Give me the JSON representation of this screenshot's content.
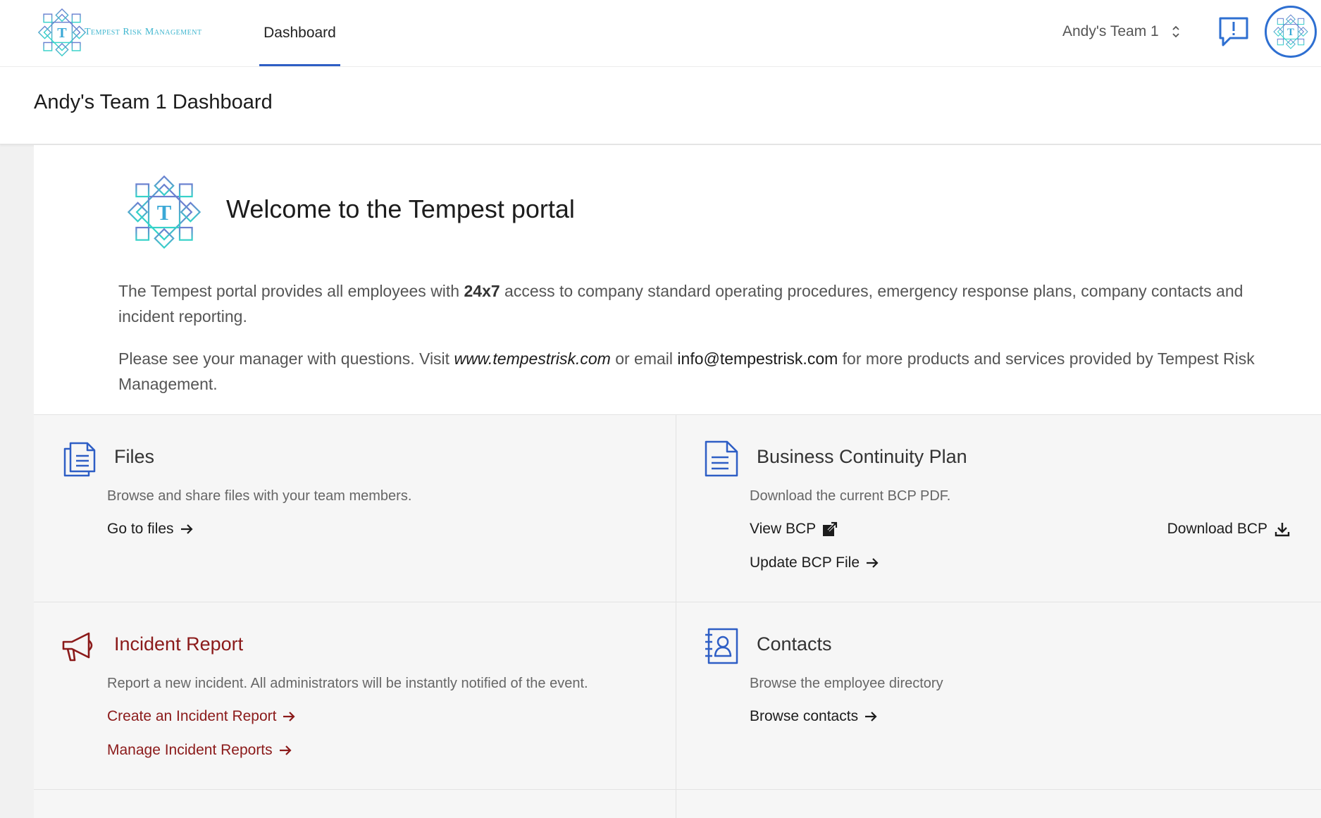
{
  "brand": {
    "name": "Tempest Risk Management",
    "logo_icon": "tempest-t-diamond-logo"
  },
  "nav": {
    "tabs": [
      {
        "label": "Dashboard",
        "active": true
      }
    ]
  },
  "team_switcher": {
    "label": "Andy's Team 1",
    "icon": "chevron-updown-icon"
  },
  "notifications": {
    "icon": "speech-bubble-alert-icon"
  },
  "page_title": "Andy's Team 1 Dashboard",
  "welcome": {
    "title": "Welcome to the Tempest portal",
    "intro_1_before": "The Tempest portal provides all employees with ",
    "intro_1_bold": "24x7",
    "intro_1_after": " access to company standard operating procedures, emergency response plans, company contacts and incident reporting.",
    "intro_2_before": "Please see your manager with questions. Visit ",
    "intro_2_site": "www.tempestrisk.com",
    "intro_2_mid": " or email ",
    "intro_2_email": "info@tempestrisk.com",
    "intro_2_after": " for more products and services provided by Tempest Risk Management."
  },
  "tiles": {
    "files": {
      "title": "Files",
      "description": "Browse and share files with your team members.",
      "links": [
        "Go to files"
      ],
      "icon": "document-stack-icon"
    },
    "bcp": {
      "title": "Business Continuity Plan",
      "description": "Download the current BCP PDF.",
      "view_label": "View BCP",
      "download_label": "Download BCP",
      "update_label": "Update BCP File",
      "icon": "document-icon"
    },
    "incident": {
      "title": "Incident Report",
      "description": "Report a new incident. All administrators will be instantly notified of the event.",
      "create_label": "Create an Incident Report",
      "manage_label": "Manage Incident Reports",
      "icon": "megaphone-icon"
    },
    "contacts": {
      "title": "Contacts",
      "description": "Browse the employee directory",
      "browse_label": "Browse contacts",
      "icon": "address-book-icon"
    }
  },
  "colors": {
    "accent_blue": "#2e5ec5",
    "incident_red": "#8b1a1a",
    "logo_teal": "#3fb6cf"
  }
}
